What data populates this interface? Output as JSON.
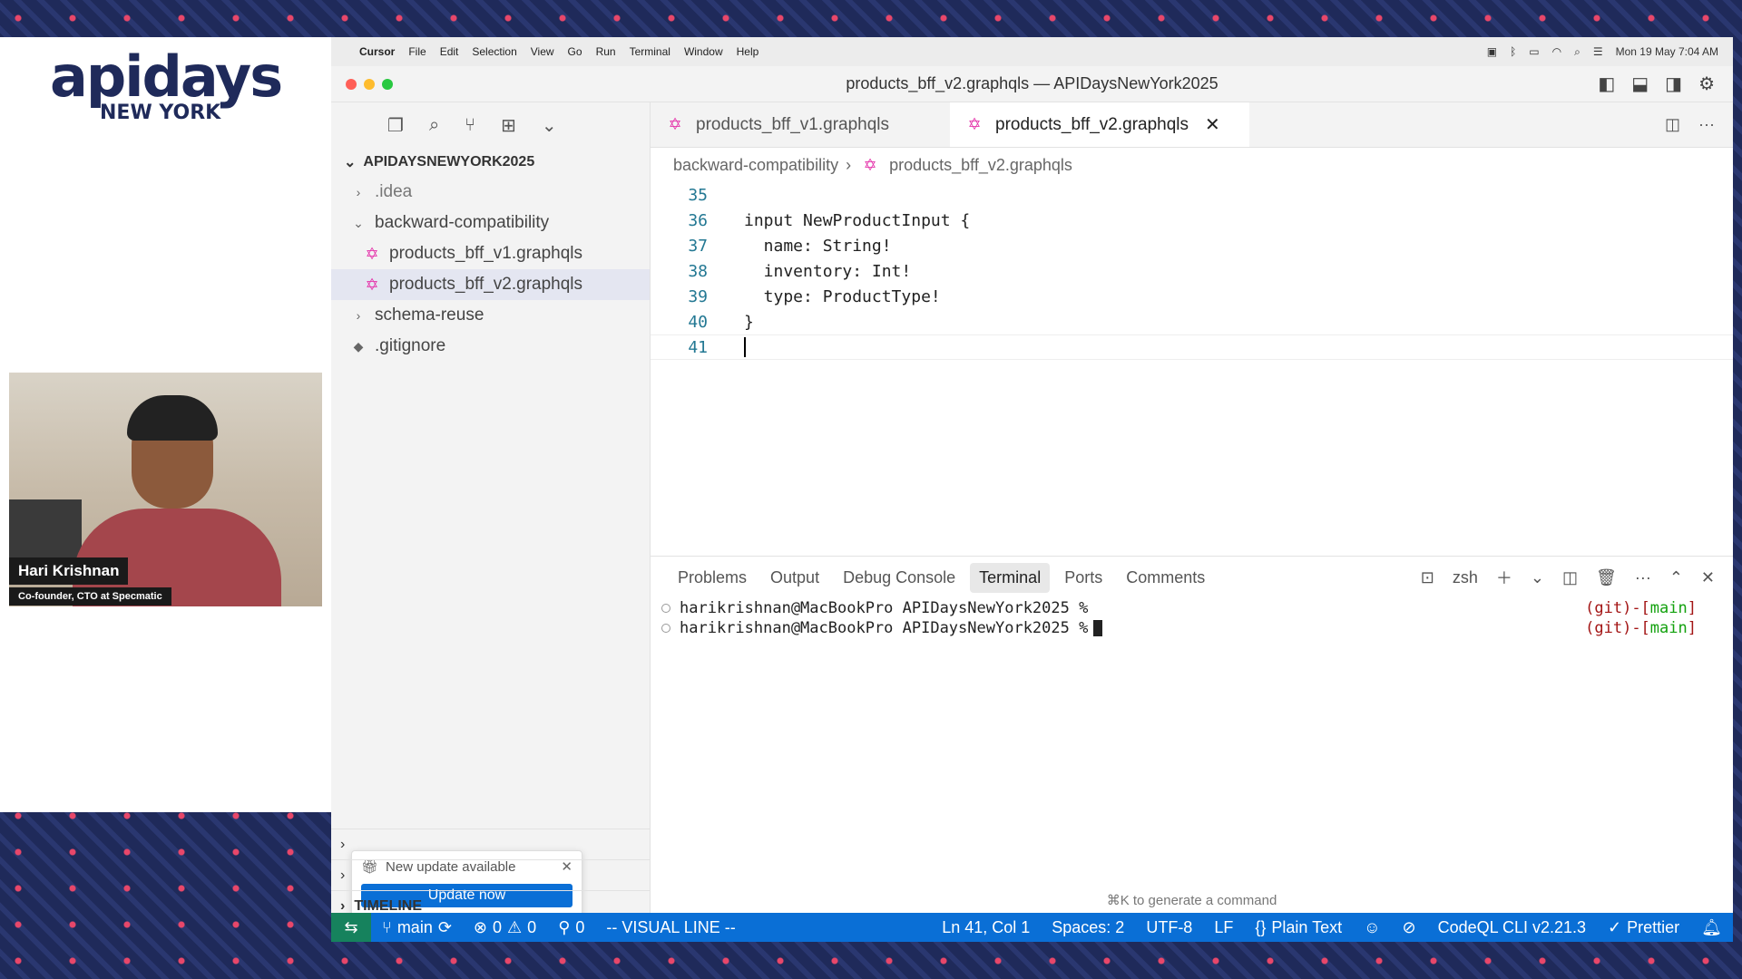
{
  "branding": {
    "logo_main": "apidays",
    "logo_sub": "NEW YORK",
    "colors": {
      "navy": "#1f2a5a",
      "pink": "#e8476a"
    }
  },
  "presenter": {
    "name": "Hari Krishnan",
    "role": "Co-founder, CTO at Specmatic"
  },
  "menubar": {
    "app": "Cursor",
    "items": [
      "File",
      "Edit",
      "Selection",
      "View",
      "Go",
      "Run",
      "Terminal",
      "Window",
      "Help"
    ],
    "datetime": "Mon 19 May  7:04 AM"
  },
  "window": {
    "title": "products_bff_v2.graphqls — APIDaysNewYork2025"
  },
  "explorer": {
    "root": "APIDAYSNEWYORK2025",
    "items": [
      {
        "label": ".idea"
      },
      {
        "label": "backward-compatibility"
      },
      {
        "label": "products_bff_v1.graphqls"
      },
      {
        "label": "products_bff_v2.graphqls"
      },
      {
        "label": "schema-reuse"
      },
      {
        "label": ".gitignore"
      }
    ],
    "timeline_label": "TIMELINE"
  },
  "update": {
    "title": "New update available",
    "button": "Update now"
  },
  "tabs": [
    {
      "label": "products_bff_v1.graphqls"
    },
    {
      "label": "products_bff_v2.graphqls"
    }
  ],
  "breadcrumb": {
    "folder": "backward-compatibility",
    "file": "products_bff_v2.graphqls"
  },
  "code": {
    "lines": [
      {
        "num": "35",
        "text": ""
      },
      {
        "num": "36",
        "text": "input NewProductInput {"
      },
      {
        "num": "37",
        "text": "  name: String!"
      },
      {
        "num": "38",
        "text": "  inventory: Int!"
      },
      {
        "num": "39",
        "text": "  type: ProductType!"
      },
      {
        "num": "40",
        "text": "}"
      },
      {
        "num": "41",
        "text": ""
      }
    ]
  },
  "panel": {
    "tabs": [
      "Problems",
      "Output",
      "Debug Console",
      "Terminal",
      "Ports",
      "Comments"
    ],
    "shell": "zsh",
    "terminal_lines": [
      {
        "prompt": "harikrishnan@MacBookPro APIDaysNewYork2025 %",
        "git_prefix": "(git)-[",
        "branch": "main",
        "git_suffix": "]"
      },
      {
        "prompt": "harikrishnan@MacBookPro APIDaysNewYork2025 %",
        "git_prefix": "(git)-[",
        "branch": "main",
        "git_suffix": "]"
      }
    ],
    "hint": "⌘K to generate a command"
  },
  "statusbar": {
    "branch": "main",
    "errors": "0",
    "warnings": "0",
    "ports": "0",
    "mode": "-- VISUAL LINE --",
    "position": "Ln 41, Col 1",
    "spaces": "Spaces: 2",
    "encoding": "UTF-8",
    "eol": "LF",
    "language": "Plain Text",
    "codeql": "CodeQL CLI v2.21.3",
    "prettier": "Prettier"
  }
}
